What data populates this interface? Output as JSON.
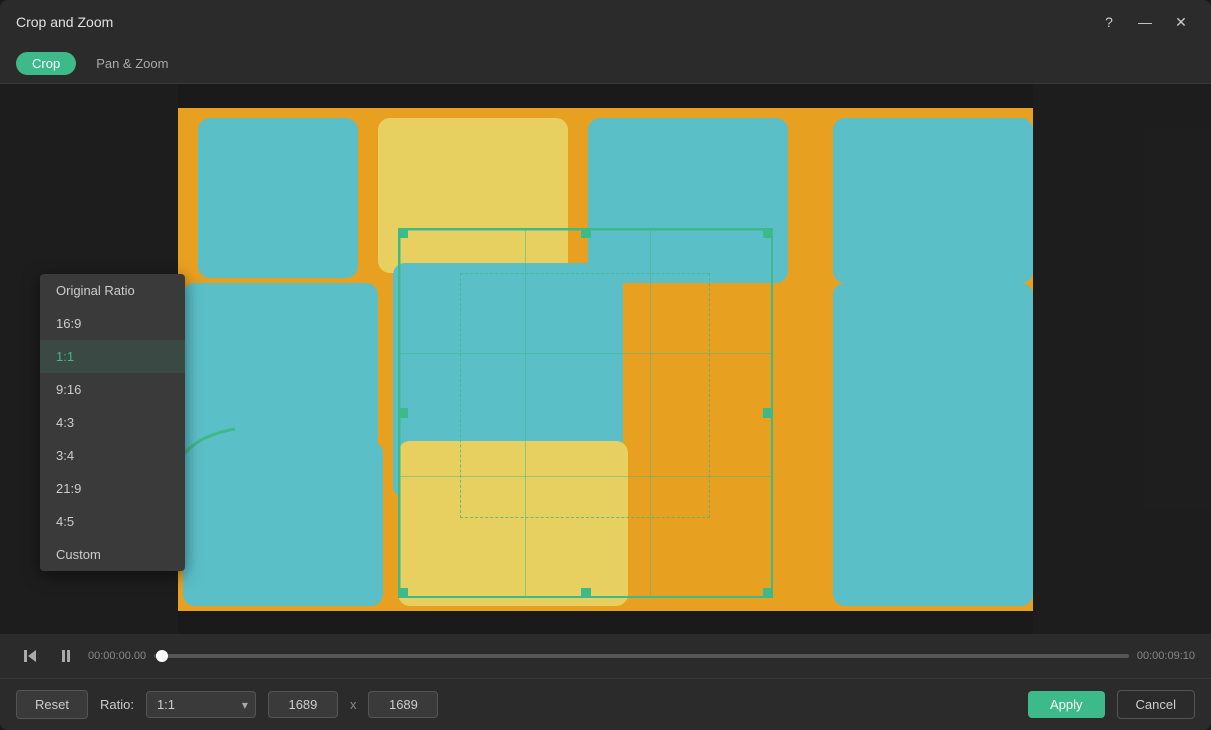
{
  "window": {
    "title": "Crop and Zoom",
    "help_label": "?",
    "minimize_label": "—",
    "close_label": "✕"
  },
  "tabs": [
    {
      "id": "crop",
      "label": "Crop",
      "active": true
    },
    {
      "id": "pan-zoom",
      "label": "Pan & Zoom",
      "active": false
    }
  ],
  "dropdown": {
    "items": [
      {
        "label": "Original Ratio",
        "value": "original"
      },
      {
        "label": "16:9",
        "value": "16:9"
      },
      {
        "label": "1:1",
        "value": "1:1",
        "selected": true
      },
      {
        "label": "9:16",
        "value": "9:16"
      },
      {
        "label": "4:3",
        "value": "4:3"
      },
      {
        "label": "3:4",
        "value": "3:4"
      },
      {
        "label": "21:9",
        "value": "21:9"
      },
      {
        "label": "4:5",
        "value": "4:5"
      },
      {
        "label": "Custom",
        "value": "custom"
      }
    ]
  },
  "timeline": {
    "start_time": "00:00:00.00",
    "end_time": "00:00:09:10"
  },
  "controls": {
    "ratio_label": "Ratio:",
    "ratio_value": "1:1",
    "width_value": "1689",
    "height_value": "1689",
    "x_separator": "x",
    "reset_label": "Reset",
    "apply_label": "Apply",
    "cancel_label": "Cancel"
  }
}
